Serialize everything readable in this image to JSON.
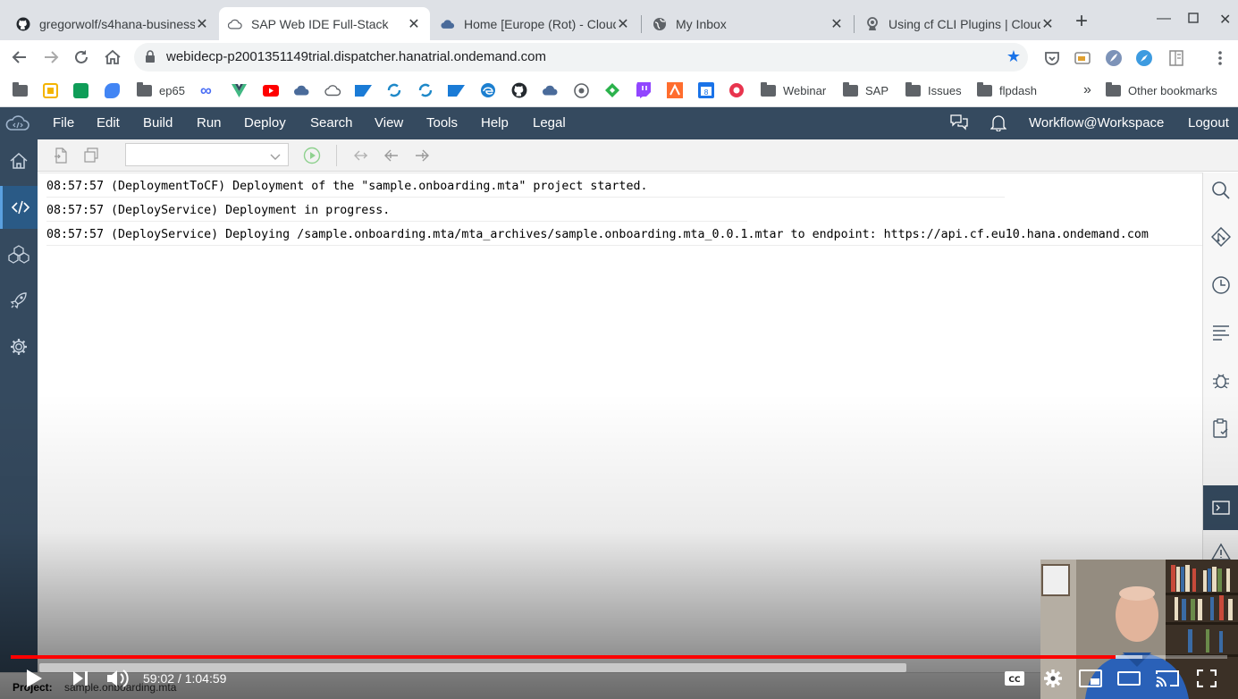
{
  "browser": {
    "tabs": [
      {
        "title": "gregorwolf/s4hana-business",
        "active": false
      },
      {
        "title": "SAP Web IDE Full-Stack",
        "active": true
      },
      {
        "title": "Home [Europe (Rot) - Cloud",
        "active": false
      },
      {
        "title": "My Inbox",
        "active": false
      },
      {
        "title": "Using cf CLI Plugins | Cloud",
        "active": false
      }
    ],
    "url": "webidecp-p2001351149trial.dispatcher.hanatrial.ondemand.com",
    "bookmarks": [
      {
        "label": "ep65",
        "type": "folder"
      },
      {
        "label": "Webinar",
        "type": "folder"
      },
      {
        "label": "SAP",
        "type": "folder"
      },
      {
        "label": "Issues",
        "type": "folder"
      },
      {
        "label": "flpdash",
        "type": "folder"
      }
    ],
    "bookmarks_overflow": "»",
    "other_bookmarks": "Other bookmarks",
    "colors": {
      "accent": "#1a73e8",
      "tabstrip": "#dee1e6"
    }
  },
  "ide": {
    "menu": [
      "File",
      "Edit",
      "Build",
      "Run",
      "Deploy",
      "Search",
      "View",
      "Tools",
      "Help",
      "Legal"
    ],
    "user": "Workflow@Workspace",
    "logout": "Logout",
    "left_sidebar": [
      "home-icon",
      "code-icon",
      "cubes-icon",
      "rocket-icon",
      "settings-icon"
    ],
    "right_sidebar": [
      "search-icon",
      "git-icon",
      "history-icon",
      "outline-icon",
      "debugger-icon",
      "clipboard-check-icon",
      "console-icon",
      "warning-icon"
    ],
    "console_lines": [
      "08:57:57 (DeploymentToCF) Deployment of the \"sample.onboarding.mta\" project started.",
      "08:57:57 (DeployService) Deployment in progress.",
      "08:57:57 (DeployService) Deploying /sample.onboarding.mta/mta_archives/sample.onboarding.mta_0.0.1.mtar to endpoint: https://api.cf.eu10.hana.ondemand.com"
    ],
    "project_label": "Project:",
    "project_name": "sample.onboarding.mta",
    "colors": {
      "shell": "#354a5f",
      "active": "#2a5a86"
    }
  },
  "video": {
    "time": "59:02 / 1:04:59",
    "progress": 0.9085,
    "buffered": 0.93,
    "colors": {
      "progress": "#ff0000"
    }
  }
}
